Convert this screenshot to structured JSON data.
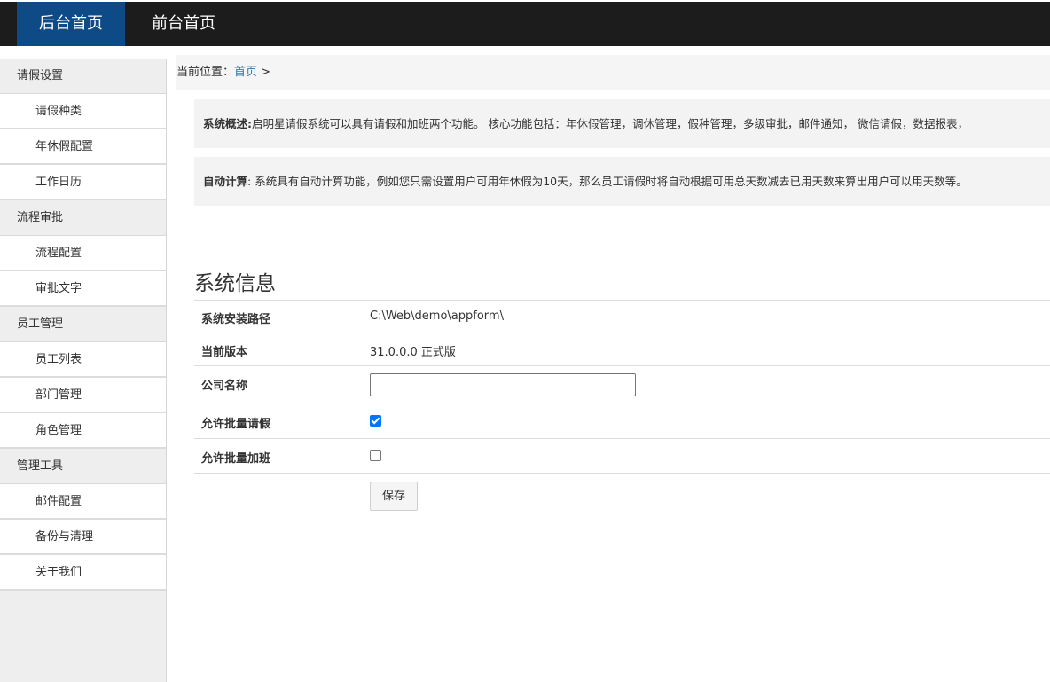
{
  "topnav": {
    "admin_home": "后台首页",
    "front_home": "前台首页"
  },
  "sidebar": {
    "groups": [
      {
        "label": "请假设置",
        "items": [
          "请假种类",
          "年休假配置",
          "工作日历"
        ]
      },
      {
        "label": "流程审批",
        "items": [
          "流程配置",
          "审批文字"
        ]
      },
      {
        "label": "员工管理",
        "items": [
          "员工列表",
          "部门管理",
          "角色管理"
        ]
      },
      {
        "label": "管理工具",
        "items": [
          "邮件配置",
          "备份与清理",
          "关于我们"
        ]
      }
    ]
  },
  "breadcrumb": {
    "prefix": "当前位置：",
    "link": "首页",
    "sep": " >"
  },
  "notes": {
    "overview_label": "系统概述:",
    "overview_text": "启明星请假系统可以具有请假和加班两个功能。 核心功能包括：年休假管理，调休管理，假种管理，多级审批，邮件通知， 微信请假，数据报表，",
    "autocalc_label": "自动计算",
    "autocalc_text": ": 系统具有自动计算功能，例如您只需设置用户可用年休假为10天，那么员工请假时将自动根据可用总天数减去已用天数来算出用户可以用天数等。"
  },
  "system_info": {
    "title": "系统信息",
    "install_path_label": "系统安装路径",
    "install_path_value": "C:\\Web\\demo\\appform\\",
    "version_label": "当前版本",
    "version_value": "31.0.0.0 正式版",
    "company_label": "公司名称",
    "company_value": "",
    "batch_leave_label": "允许批量请假",
    "batch_leave_checked": true,
    "batch_overtime_label": "允许批量加班",
    "batch_overtime_checked": false,
    "save_label": "保存"
  }
}
